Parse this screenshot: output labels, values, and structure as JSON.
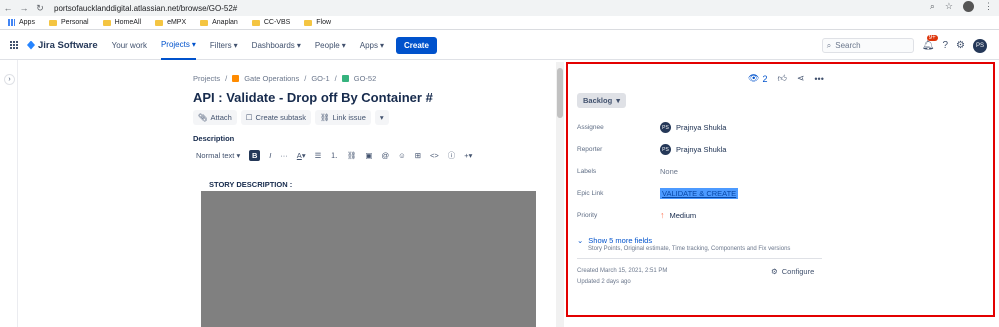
{
  "browser": {
    "url": "portsofaucklanddigital.atlassian.net/browse/GO-52#",
    "bookmarks": [
      "Apps",
      "Personal",
      "HomeAll",
      "eMPX",
      "Anaplan",
      "CC-VBS",
      "Flow"
    ]
  },
  "jira_nav": {
    "product": "Jira Software",
    "items": [
      {
        "label": "Your work"
      },
      {
        "label": "Projects"
      },
      {
        "label": "Filters"
      },
      {
        "label": "Dashboards"
      },
      {
        "label": "People"
      },
      {
        "label": "Apps"
      }
    ],
    "create_label": "Create",
    "search_placeholder": "Search",
    "notification_count": "9+",
    "user_initials": "PS"
  },
  "breadcrumb": {
    "projects": "Projects",
    "project": "Gate Operations",
    "parent": "GO-1",
    "issue": "GO-52"
  },
  "issue": {
    "title": "API : Validate - Drop off By Container #",
    "actions": [
      "Attach",
      "Create subtask",
      "Link issue"
    ],
    "description_label": "Description",
    "text_style": "Normal text",
    "story_heading": "STORY DESCRIPTION :"
  },
  "details": {
    "watch_count": "2",
    "status": "Backlog",
    "fields": [
      {
        "label": "Assignee",
        "value": "Prajnya Shukla",
        "initials": "PS"
      },
      {
        "label": "Reporter",
        "value": "Prajnya Shukla",
        "initials": "PS"
      },
      {
        "label": "Labels",
        "value": "None"
      },
      {
        "label": "Epic Link",
        "value": "VALIDATE & CREATE"
      },
      {
        "label": "Priority",
        "value": "Medium"
      }
    ],
    "more_fields": "Show 5 more fields",
    "more_fields_sub": "Story Points, Original estimate, Time tracking, Components and Fix versions",
    "created": "Created March 15, 2021, 2:51 PM",
    "updated": "Updated 2 days ago",
    "configure": "Configure"
  },
  "colors": {
    "accent": "#0052cc",
    "highlight_border": "#e30000",
    "redaction": "#808080"
  }
}
